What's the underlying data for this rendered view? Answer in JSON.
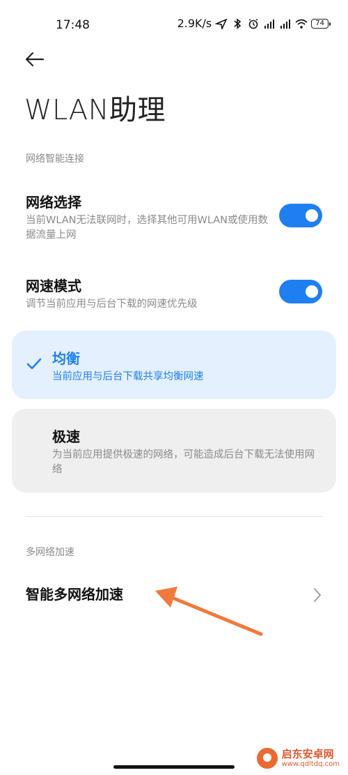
{
  "status_bar": {
    "time": "17:48",
    "speed": "2.9K/s",
    "battery": "74"
  },
  "header": {
    "title": "WLAN助理"
  },
  "section_smart": {
    "label": "网络智能连接",
    "network_select": {
      "title": "网络选择",
      "desc": "当前WLAN无法联网时，选择其他可用WLAN或使用数据流量上网",
      "enabled": true
    },
    "speed_mode": {
      "title": "网速模式",
      "desc": "调节当前应用与后台下载的网速优先级",
      "enabled": true
    },
    "options": [
      {
        "title": "均衡",
        "desc": "当前应用与后台下载共享均衡网速",
        "selected": true
      },
      {
        "title": "极速",
        "desc": "为当前应用提供极速的网络，可能造成后台下载无法使用网络",
        "selected": false
      }
    ]
  },
  "section_multi": {
    "label": "多网络加速",
    "item": {
      "title": "智能多网络加速"
    }
  },
  "watermark": {
    "name": "启东安卓网",
    "url": "www.qdltdq.com"
  },
  "colors": {
    "accent": "#1f7ff0",
    "selected_bg": "#e4f0fd",
    "card_bg": "#efefef",
    "annotation_arrow": "#f07a3c"
  }
}
